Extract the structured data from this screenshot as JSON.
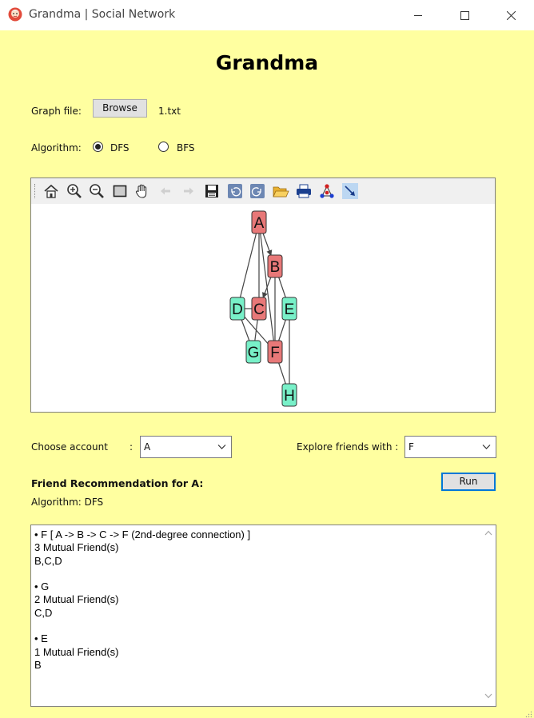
{
  "window": {
    "title": "Grandma | Social Network",
    "minimize_icon": "minimize-icon",
    "maximize_icon": "maximize-icon",
    "close_icon": "close-icon"
  },
  "app": {
    "title": "Grandma"
  },
  "graph_file": {
    "label": "Graph file:",
    "browse_label": "Browse",
    "file_name": "1.txt"
  },
  "algorithm": {
    "label": "Algorithm:",
    "options": [
      {
        "label": "DFS",
        "selected": true
      },
      {
        "label": "BFS",
        "selected": false
      }
    ]
  },
  "toolbar": {
    "icons": [
      "home-icon",
      "zoom-in-icon",
      "zoom-out-icon",
      "select-rect-icon",
      "pan-hand-icon",
      "back-arrow-icon",
      "forward-arrow-icon",
      "save-icon",
      "undo-icon",
      "redo-icon",
      "open-folder-icon",
      "print-icon",
      "graph-layout-icon",
      "arrow-tool-icon"
    ]
  },
  "graph": {
    "colors": {
      "visited": "#e87878",
      "unvisited": "#78f0c8",
      "edge": "#444444"
    },
    "nodes": [
      {
        "id": "A",
        "visited": true
      },
      {
        "id": "B",
        "visited": true
      },
      {
        "id": "C",
        "visited": true
      },
      {
        "id": "D",
        "visited": false
      },
      {
        "id": "E",
        "visited": false
      },
      {
        "id": "F",
        "visited": true
      },
      {
        "id": "G",
        "visited": false
      },
      {
        "id": "H",
        "visited": false
      }
    ],
    "edges": [
      [
        "A",
        "B"
      ],
      [
        "A",
        "D"
      ],
      [
        "A",
        "F"
      ],
      [
        "B",
        "C"
      ],
      [
        "B",
        "E"
      ],
      [
        "B",
        "F"
      ],
      [
        "C",
        "D"
      ],
      [
        "C",
        "G"
      ],
      [
        "D",
        "F"
      ],
      [
        "D",
        "G"
      ],
      [
        "E",
        "F"
      ],
      [
        "E",
        "H"
      ],
      [
        "F",
        "H"
      ],
      [
        "A",
        "C"
      ]
    ]
  },
  "choose_account": {
    "label": "Choose account",
    "colon": ":",
    "value": "A"
  },
  "explore": {
    "label": "Explore friends with :",
    "value": "F"
  },
  "run_label": "Run",
  "recommendation": {
    "heading": "Friend Recommendation for A:",
    "algorithm_line": "Algorithm: DFS"
  },
  "results": {
    "lines": [
      "• F [ A -> B -> C -> F (2nd-degree connection) ]",
      "3 Mutual Friend(s)",
      "B,C,D",
      "",
      "• G",
      "2 Mutual Friend(s)",
      "C,D",
      "",
      "• E",
      "1 Mutual Friend(s)",
      "B"
    ]
  }
}
